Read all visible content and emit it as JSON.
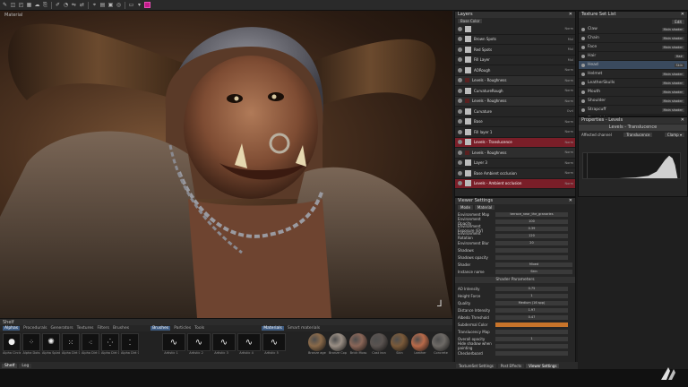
{
  "viewport": {
    "title": "Material"
  },
  "layers": {
    "title": "Layers",
    "channel": "Base Color",
    "items": [
      {
        "name": "",
        "blend": "Norm",
        "kind": "layer"
      },
      {
        "name": "Brown Spots",
        "blend": "Mul",
        "kind": "layer"
      },
      {
        "name": "Red Spots",
        "blend": "Mul",
        "kind": "layer"
      },
      {
        "name": "Fill Layer",
        "blend": "Mul",
        "kind": "layer"
      },
      {
        "name": "AORough",
        "blend": "Norm",
        "kind": "layer"
      },
      {
        "name": "Levels - Roughness",
        "blend": "Norm",
        "kind": "sub"
      },
      {
        "name": "CurvatureRough",
        "blend": "Norm",
        "kind": "layer"
      },
      {
        "name": "Levels - Roughness",
        "blend": "Norm",
        "kind": "sub"
      },
      {
        "name": "Curvature",
        "blend": "Ovrl",
        "kind": "layer"
      },
      {
        "name": "Base",
        "blend": "Norm",
        "kind": "layer"
      },
      {
        "name": "Fill layer 1",
        "blend": "Norm",
        "kind": "layer"
      },
      {
        "name": "Levels - Translucence",
        "blend": "Norm",
        "kind": "red"
      },
      {
        "name": "Levels - Roughness",
        "blend": "Norm",
        "kind": "sub"
      },
      {
        "name": "Layer 3",
        "blend": "Norm",
        "kind": "layer"
      },
      {
        "name": "Base Ambient occlusion",
        "blend": "Norm",
        "kind": "layer"
      },
      {
        "name": "Levels - Ambient occlusion",
        "blend": "Norm",
        "kind": "red"
      }
    ]
  },
  "texture_set": {
    "title": "Texture Set List",
    "btn": "Edit",
    "items": [
      {
        "name": "Claw",
        "shader": "Main shader"
      },
      {
        "name": "Chain",
        "shader": "Main shader"
      },
      {
        "name": "Face",
        "shader": "Main shader"
      },
      {
        "name": "Hair",
        "shader": "Hair"
      },
      {
        "name": "Head",
        "shader": "Skin"
      },
      {
        "name": "Helmet",
        "shader": "Main shader"
      },
      {
        "name": "LeatherSkulls",
        "shader": "Main shader"
      },
      {
        "name": "Mouth",
        "shader": "Main shader"
      },
      {
        "name": "Shoulder",
        "shader": "Main shader"
      },
      {
        "name": "Strapcuff",
        "shader": "Main shader"
      },
      {
        "name": "Strapright",
        "shader": "Main shader"
      }
    ]
  },
  "properties": {
    "title": "Properties - Levels",
    "subtitle": "Levels - Translucence",
    "channel_label": "Affected channel",
    "channel_value": "Translucence",
    "clamp": "Clamp ▾",
    "buttons": [
      "Reset",
      "Auto",
      "Invert",
      "Clamp"
    ]
  },
  "viewer": {
    "title": "Viewer Settings",
    "tabs": [
      "Mode",
      "Material"
    ],
    "rows": [
      {
        "label": "Environment Map",
        "value": "terrace_near_the_granaries"
      },
      {
        "label": "Environment Opacity",
        "value": "100"
      },
      {
        "label": "Environment Exposure (EV)",
        "value": "0.39"
      },
      {
        "label": "Environment Rotation",
        "value": "120"
      },
      {
        "label": "Environment Blur",
        "value": "20"
      },
      {
        "label": "Shadows",
        "value": ""
      },
      {
        "label": "Shadows opacity",
        "value": ""
      }
    ],
    "shader": {
      "label": "Shader",
      "value": "Mixed"
    },
    "instance": {
      "label": "Instance name",
      "value": "Skin"
    },
    "section": "Shader Parameters",
    "params": [
      {
        "label": "AO Intensity",
        "value": "0.75"
      },
      {
        "label": "Height Force",
        "value": "1"
      },
      {
        "label": "Quality",
        "value": "Medium (16 spp)"
      },
      {
        "label": "Distance Intensity",
        "value": "1.97"
      },
      {
        "label": "Albedo Threshold",
        "value": "0.47"
      },
      {
        "label": "Subdermal Color",
        "value": ""
      },
      {
        "label": "Translucency Map",
        "value": ""
      }
    ],
    "extra": [
      {
        "label": "Overall opacity",
        "value": "1"
      },
      {
        "label": "Hide shadow when painting",
        "value": ""
      },
      {
        "label": "Checkerboard",
        "value": ""
      }
    ],
    "subdermal_color": "#c8742a",
    "bottom_tabs": [
      "TextureSet Settings",
      "Post Effects",
      "Viewer Settings"
    ]
  },
  "shelf": {
    "title": "Shelf",
    "categories": [
      "Alphas",
      "Procedurals",
      "Generators",
      "Textures",
      "Filters",
      "Brushes"
    ],
    "alphas": [
      "Alpha Circle",
      "Alpha Dots",
      "Alpha Splat",
      "Alpha Dirt 01",
      "Alpha Dirt 02",
      "Alpha Dirt 03",
      "Alpha Dirt 04"
    ],
    "brush_tabs": [
      "Brushes",
      "Particles",
      "Tools"
    ],
    "brushes": [
      "Artistic 1",
      "Artistic 2",
      "Artistic 3",
      "Artistic 4",
      "Artistic 5"
    ],
    "material_tabs": [
      "Materials",
      "Smart materials"
    ],
    "materials": [
      "Bronze aged",
      "Bronze Copper",
      "Brick Moss",
      "Cast iron",
      "Skin",
      "Leather",
      "Concrete"
    ],
    "material_colors": [
      "#8a6a4a",
      "#9a8f85",
      "#8a6658",
      "#5a5350",
      "#7a5a3a",
      "#b86a4a",
      "#6e6a66"
    ],
    "bottom_tabs": [
      "Shelf",
      "Log"
    ]
  }
}
